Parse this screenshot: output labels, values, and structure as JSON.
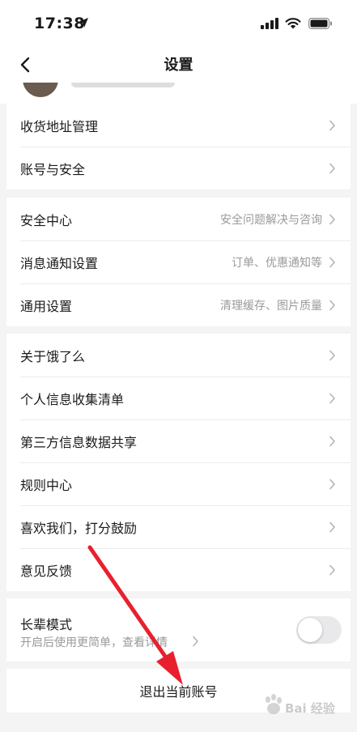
{
  "status_bar": {
    "time": "17:38"
  },
  "nav": {
    "title": "设置"
  },
  "group1": [
    {
      "label": "收货地址管理"
    },
    {
      "label": "账号与安全"
    }
  ],
  "group2": [
    {
      "label": "安全中心",
      "sub": "安全问题解决与咨询"
    },
    {
      "label": "消息通知设置",
      "sub": "订单、优惠通知等"
    },
    {
      "label": "通用设置",
      "sub": "清理缓存、图片质量"
    }
  ],
  "group3": [
    {
      "label": "关于饿了么"
    },
    {
      "label": "个人信息收集清单"
    },
    {
      "label": "第三方信息数据共享"
    },
    {
      "label": "规则中心"
    },
    {
      "label": "喜欢我们，打分鼓励"
    },
    {
      "label": "意见反馈"
    }
  ],
  "elder_mode": {
    "title": "长辈模式",
    "subtitle": "开启后使用更简单，查看详情",
    "enabled": false
  },
  "logout": {
    "label": "退出当前账号"
  },
  "watermark": {
    "text": "Bai 经验"
  },
  "colors": {
    "arrow": "#e8202e",
    "toggle_off": "#e9e9eb",
    "chevron": "#b3b3b3"
  }
}
